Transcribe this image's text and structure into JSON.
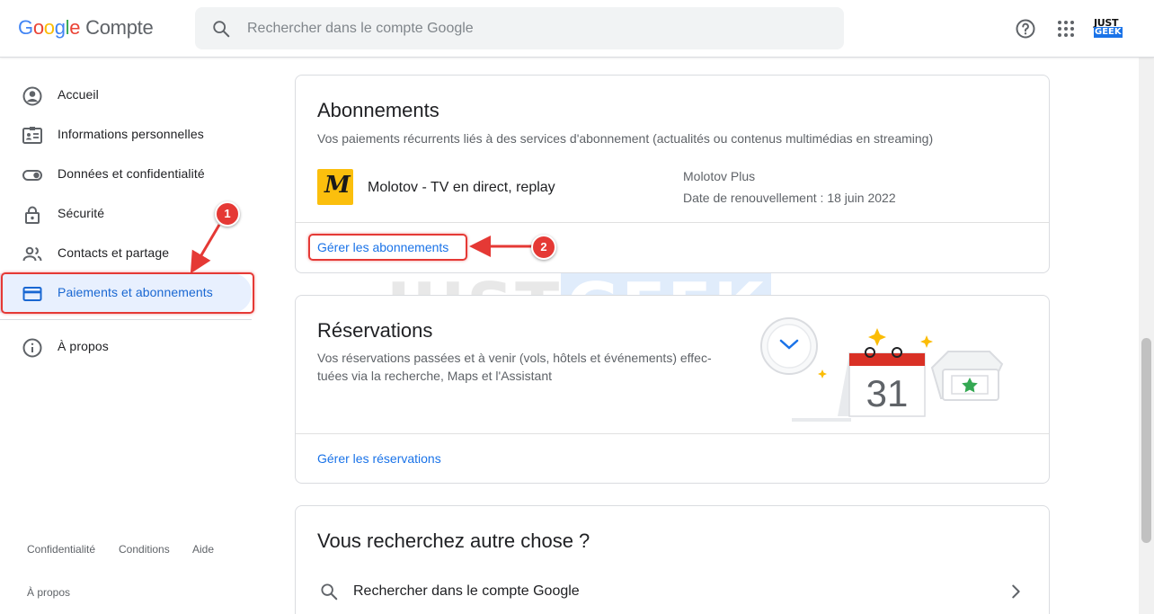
{
  "header": {
    "logo_google": "Google",
    "logo_product": "Compte",
    "search_placeholder": "Rechercher dans le compte Google",
    "avatar_line1": "JUST",
    "avatar_line2": "GEEK"
  },
  "sidebar": {
    "items": [
      {
        "label": "Accueil",
        "icon": "account-circle-icon"
      },
      {
        "label": "Informations personnelles",
        "icon": "id-card-icon"
      },
      {
        "label": "Données et confidentialité",
        "icon": "toggle-icon"
      },
      {
        "label": "Sécurité",
        "icon": "lock-icon"
      },
      {
        "label": "Contacts et partage",
        "icon": "people-icon"
      },
      {
        "label": "Paiements et abonnements",
        "icon": "credit-card-icon",
        "active": true
      },
      {
        "label": "À propos",
        "icon": "info-icon"
      }
    ],
    "footer": {
      "privacy": "Confidentialité",
      "terms": "Conditions",
      "help": "Aide",
      "about": "À propos"
    }
  },
  "annotations": {
    "marker1": "1",
    "marker2": "2",
    "color": "#e53935"
  },
  "watermark": {
    "part1": "JUST",
    "part2": "GEEK"
  },
  "subscriptions": {
    "title": "Abonnements",
    "description": "Vos paiements récurrents liés à des services d'abonnement (actualités ou contenus multimédias en streaming)",
    "item": {
      "logo_letter": "M",
      "name": "Molotov - TV en direct, replay",
      "plan": "Molotov Plus",
      "renewal": "Date de renouvellement : 18 juin 2022"
    },
    "manage_link": "Gérer les abonnements"
  },
  "reservations": {
    "title": "Réservations",
    "description_line1": "Vos réservations passées et à venir (vols, hôtels et événements) effec-",
    "description_line2": "tuées via la recherche, Maps et l'Assistant",
    "calendar_day": "31",
    "manage_link": "Gérer les réservations"
  },
  "looking_else": {
    "title": "Vous recherchez autre chose ?",
    "search_row": "Rechercher dans le compte Google"
  },
  "colors": {
    "accent": "#1a73e8",
    "active_bg": "#e8f0fe",
    "annotation": "#e53935"
  }
}
